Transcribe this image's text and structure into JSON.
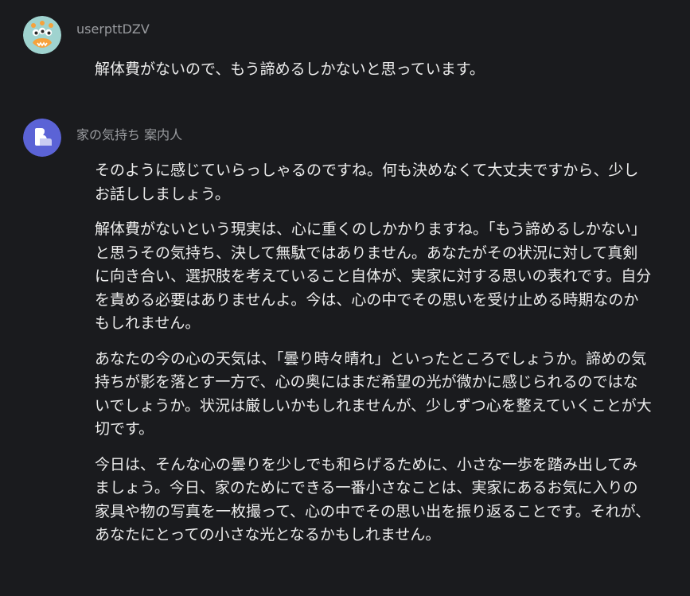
{
  "messages": [
    {
      "author": "userpttDZV",
      "paragraphs": [
        "解体費がないので、もう諦めるしかないと思っています。"
      ]
    },
    {
      "author": "家の気持ち 案内人",
      "paragraphs": [
        "そのように感じていらっしゃるのですね。何も決めなくて大丈夫ですから、少しお話ししましょう。",
        "解体費がないという現実は、心に重くのしかかりますね。「もう諦めるしかない」と思うその気持ち、決して無駄ではありません。あなたがその状況に対して真剣に向き合い、選択肢を考えていること自体が、実家に対する思いの表れです。自分を責める必要はありませんよ。今は、心の中でその思いを受け止める時期なのかもしれません。",
        "あなたの今の心の天気は、「曇り時々晴れ」といったところでしょうか。諦めの気持ちが影を落とす一方で、心の奥にはまだ希望の光が微かに感じられるのではないでしょうか。状況は厳しいかもしれませんが、少しずつ心を整えていくことが大切です。",
        "今日は、そんな心の曇りを少しでも和らげるために、小さな一歩を踏み出してみましょう。今日、家のためにできる一番小さなことは、実家にあるお気に入りの家具や物の写真を一枚撮って、心の中でその思い出を振り返ることです。それが、あなたにとっての小さな光となるかもしれません。"
      ]
    }
  ],
  "colors": {
    "background": "#1a1b1e",
    "author_text": "#9a9ca0",
    "message_text": "#ececec",
    "bot_avatar": "#5b63d6",
    "user_avatar": "#9fd3cf"
  },
  "icons": {
    "user_avatar": "monster-avatar-icon",
    "bot_avatar": "bot-logo-icon"
  }
}
